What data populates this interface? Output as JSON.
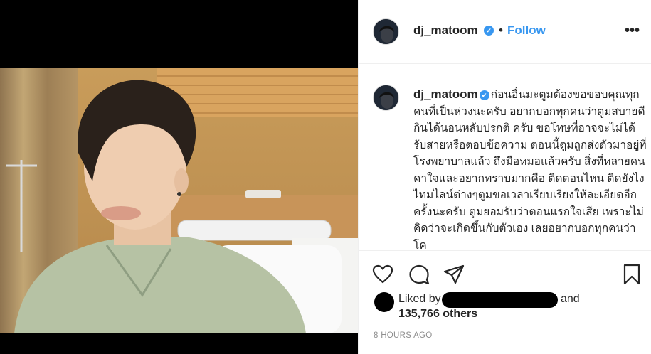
{
  "post": {
    "username": "dj_matoom",
    "verified_badge": "✔",
    "dot": "•",
    "follow_label": "Follow",
    "more_label": "•••",
    "caption": "ก่อนอื่นมะตูมต้องขอขอบคุณทุกคนที่เป็นห่วงนะครับ อยากบอกทุกคนว่าตูมสบายดี กินได้นอนหลับปรกติ ครับ ขอโทษที่อาจจะไม่ได้รับสายหรือตอบข้อความ ตอนนี้ตูมถูกส่งตัวมาอยู่ที่โรงพยาบาลแล้ว ถึงมือหมอแล้วครับ สิ่งที่หลายคนคาใจและอยากทราบมากคือ ติดตอนไหน ติดยังไง ไทมไลน์ต่างๆตูมขอเวลาเรียบเรียงให้ละเอียดอีกครั้งนะครับ ตูมยอมรับว่าตอนแรกใจเสีย เพราะไม่คิดว่าจะเกิดขึ้นกับตัวเอง เลยอยากบอกทุกคนว่า โค",
    "liked_by_label": "Liked by",
    "and_label": "and",
    "others_label": "135,766 others",
    "time_label": "8 HOURS AGO"
  },
  "icons": {
    "like": "heart-icon",
    "comment": "comment-icon",
    "share": "paper-plane-icon",
    "save": "bookmark-icon"
  },
  "colors": {
    "accent": "#3897f0",
    "text": "#262626",
    "muted": "#8e8e8e",
    "border": "#efefef"
  }
}
